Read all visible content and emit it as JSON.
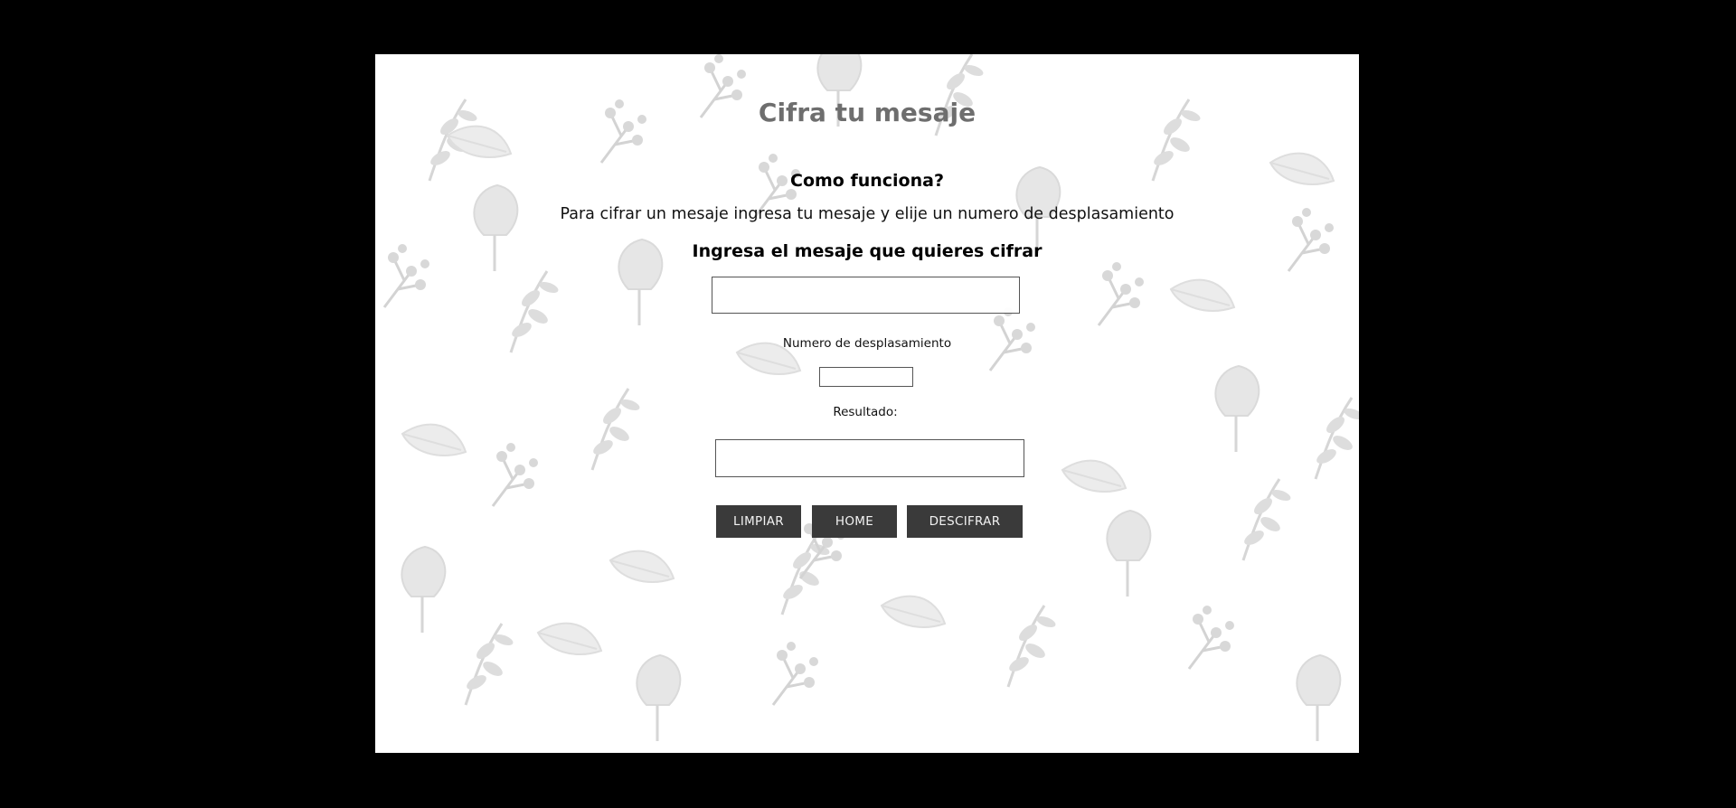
{
  "page": {
    "title": "Cifra tu mesaje",
    "subtitle": "Como funciona?",
    "description": "Para cifrar un mesaje ingresa tu mesaje y elije un numero de desplasamiento",
    "message_prompt": "Ingresa el mesaje que quieres cifrar"
  },
  "form": {
    "message_value": "",
    "message_placeholder": "",
    "shift_label": "Numero de desplasamiento",
    "shift_value": "",
    "result_label": "Resultado:",
    "result_value": ""
  },
  "buttons": {
    "clear_label": "LIMPIAR",
    "home_label": "HOME",
    "decrypt_label": "DESCIFRAR"
  },
  "colors": {
    "page_background": "#000000",
    "panel_background": "#ffffff",
    "title_color": "#6e6e6e",
    "button_background": "#3a3a3a",
    "button_text": "#f2f2f2",
    "pattern_color": "#d9d9d9"
  }
}
